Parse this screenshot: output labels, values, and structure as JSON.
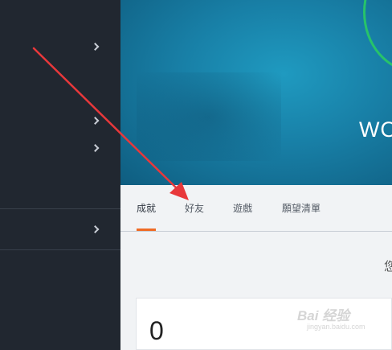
{
  "profile": {
    "name_partial": "WO"
  },
  "tabs": [
    {
      "label": "成就",
      "active": true
    },
    {
      "label": "好友",
      "active": false
    },
    {
      "label": "遊戲",
      "active": false
    },
    {
      "label": "願望清單",
      "active": false
    }
  ],
  "main": {
    "side_note_partial": "您",
    "stat_card": {
      "value": "0"
    }
  },
  "watermark": {
    "brand": "Bai 经验",
    "url": "jingyan.baidu.com"
  },
  "colors": {
    "sidebar_bg": "#212730",
    "hero_blue": "#187fa6",
    "avatar_ring": "#27c36a",
    "tab_accent": "#ef6b25",
    "annotation_arrow": "#e8383b"
  }
}
